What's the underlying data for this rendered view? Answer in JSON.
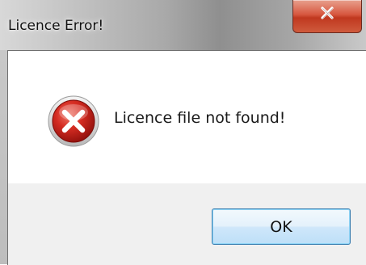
{
  "window": {
    "title": "Licence Error!"
  },
  "titlebar": {
    "close_icon": "close-icon"
  },
  "dialog": {
    "icon": "error-icon",
    "message": "Licence file not found!"
  },
  "buttons": {
    "ok_label": "OK"
  },
  "colors": {
    "error_red": "#d32f2f",
    "close_button": "#c94a32",
    "button_border": "#3c7fb1",
    "footer_bg": "#f0f0f0"
  }
}
